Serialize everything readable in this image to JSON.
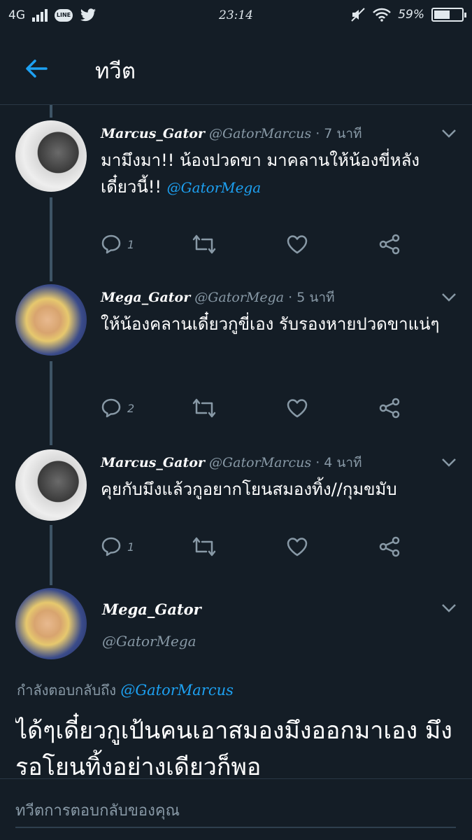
{
  "status_bar": {
    "network": "4G",
    "line_badge": "LINE",
    "time": "23:14",
    "battery": "59%",
    "battery_level": 0.59
  },
  "header": {
    "back_icon": "arrow-left-icon",
    "title": "ทวีต"
  },
  "tweets": [
    {
      "name": "Marcus_Gator",
      "handle": "@GatorMarcus",
      "time": "· 7 นาที",
      "text": "มามึงมา!! น้องปวดขา มาคลานให้น้องขี่หลัง เดี๋ยวนี้!!",
      "mention": "@GatorMega",
      "replies": "1",
      "retweets": "",
      "likes": ""
    },
    {
      "name": "Mega_Gator",
      "handle": "@GatorMega",
      "time": "· 5 นาที",
      "text": "ให้น้องคลานเดี๋ยวกูขี่เอง รับรองหายปวดขาแน่ๆ",
      "mention": "",
      "replies": "2",
      "retweets": "",
      "likes": ""
    },
    {
      "name": "Marcus_Gator",
      "handle": "@GatorMarcus",
      "time": "· 4 นาที",
      "text": "คุยกับมึงแล้วกูอยากโยนสมองทิ้ง//กุมขมับ",
      "mention": "",
      "replies": "1",
      "retweets": "",
      "likes": ""
    }
  ],
  "focus_tweet": {
    "name": "Mega_Gator",
    "handle": "@GatorMega",
    "reply_to_label": "กำลังตอบกลับถึง",
    "reply_to_handle": "@GatorMarcus",
    "text": "ได้ๆเดี๋ยวกูเป้นคนเอาสมองมึงออกมาเอง มึงรอโยนทิ้งอย่างเดียวก็พอ"
  },
  "composer": {
    "placeholder": "ทวีตการตอบกลับของคุณ"
  },
  "colors": {
    "background": "#141d26",
    "accent": "#1da1f2",
    "muted": "#8899a6",
    "thread_line": "#3e5466"
  }
}
